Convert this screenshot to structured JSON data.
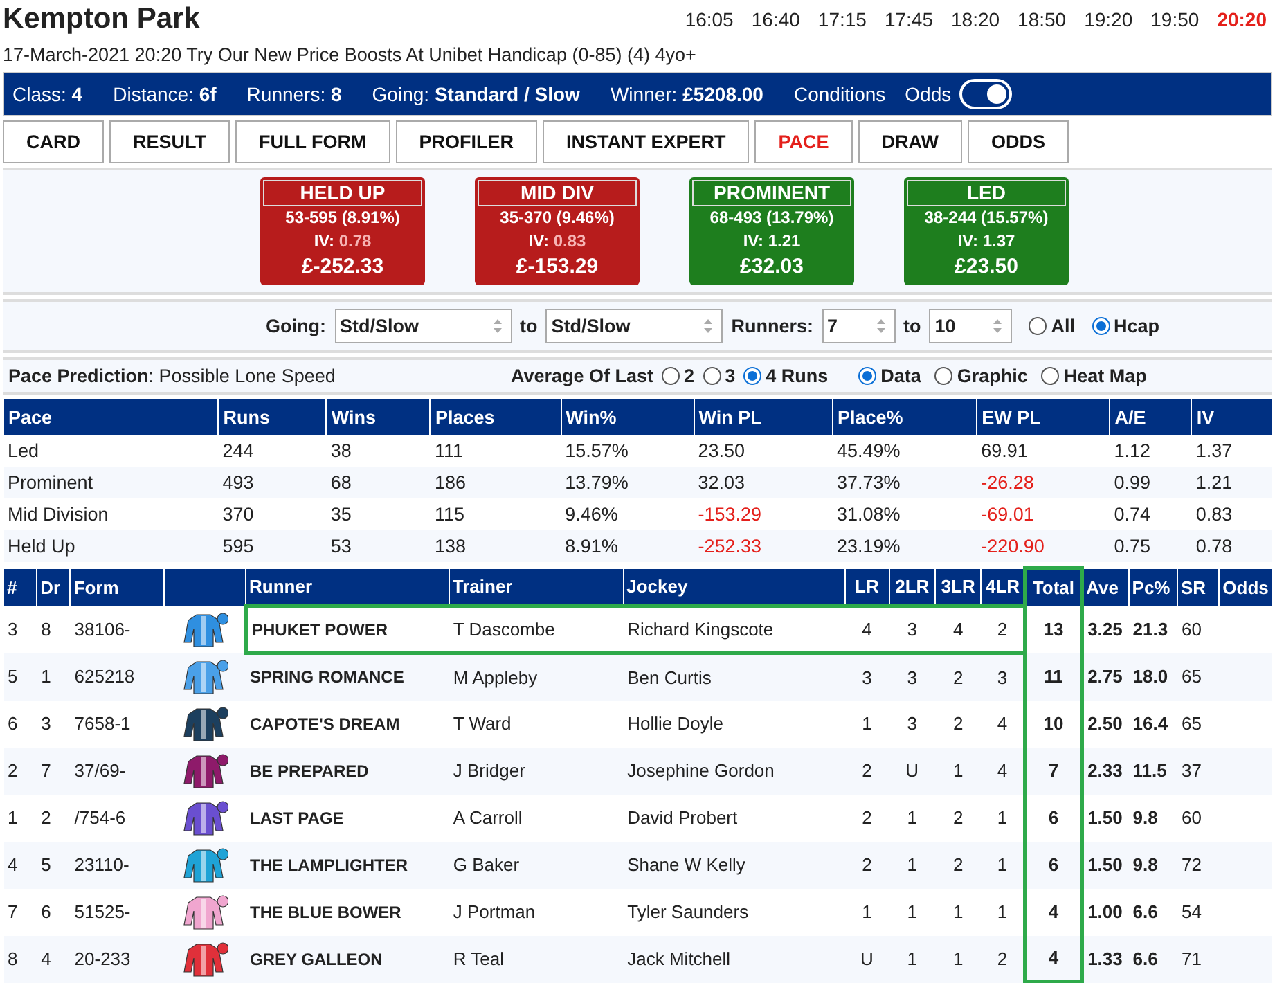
{
  "title": "Kempton Park",
  "times": [
    {
      "label": "16:05",
      "selected": false
    },
    {
      "label": "16:40",
      "selected": false
    },
    {
      "label": "17:15",
      "selected": false
    },
    {
      "label": "17:45",
      "selected": false
    },
    {
      "label": "18:20",
      "selected": false
    },
    {
      "label": "18:50",
      "selected": false
    },
    {
      "label": "19:20",
      "selected": false
    },
    {
      "label": "19:50",
      "selected": false
    },
    {
      "label": "20:20",
      "selected": true
    }
  ],
  "subtitle": "17-March-2021 20:20 Try Our New Price Boosts At Unibet Handicap (0-85) (4) 4yo+",
  "info": [
    {
      "label": "Class:",
      "value": "4"
    },
    {
      "label": "Distance:",
      "value": "6f"
    },
    {
      "label": "Runners:",
      "value": "8"
    },
    {
      "label": "Going:",
      "value": "Standard / Slow"
    },
    {
      "label": "Winner:",
      "value": "£5208.00"
    }
  ],
  "conditions": "Conditions",
  "odds_toggle": {
    "label": "Odds",
    "on": true
  },
  "tabs": [
    {
      "label": "CARD",
      "selected": false
    },
    {
      "label": "RESULT",
      "selected": false
    },
    {
      "label": "FULL FORM",
      "selected": false
    },
    {
      "label": "PROFILER",
      "selected": false
    },
    {
      "label": "INSTANT EXPERT",
      "selected": false
    },
    {
      "label": "PACE",
      "selected": true
    },
    {
      "label": "DRAW",
      "selected": false
    },
    {
      "label": "ODDS",
      "selected": false
    }
  ],
  "pace_boxes": [
    {
      "title": "HELD UP",
      "record": "53-595 (8.91%)",
      "iv_label": "IV:",
      "iv": "0.78",
      "iv_low": true,
      "pl": "£-252.33",
      "color": "#b71c1c"
    },
    {
      "title": "MID DIV",
      "record": "35-370 (9.46%)",
      "iv_label": "IV:",
      "iv": "0.83",
      "iv_low": true,
      "pl": "£-153.29",
      "color": "#b71c1c"
    },
    {
      "title": "PROMINENT",
      "record": "68-493 (13.79%)",
      "iv_label": "IV:",
      "iv": "1.21",
      "iv_low": false,
      "pl": "£32.03",
      "color": "#1e7e1e"
    },
    {
      "title": "LED",
      "record": "38-244 (15.57%)",
      "iv_label": "IV:",
      "iv": "1.37",
      "iv_low": false,
      "pl": "£23.50",
      "color": "#1e7e1e"
    }
  ],
  "filters": {
    "going_label": "Going:",
    "going_from": "Std/Slow",
    "to_label_1": "to",
    "going_to": "Std/Slow",
    "runners_label": "Runners:",
    "runners_from": "7",
    "to_label_2": "to",
    "runners_to": "10",
    "scope": [
      {
        "label": "All",
        "selected": false
      },
      {
        "label": "Hcap",
        "selected": true
      }
    ]
  },
  "prediction": {
    "label": "Pace Prediction",
    "value": ": Possible Lone Speed",
    "average_label": "Average Of Last",
    "average": [
      {
        "label": "2",
        "selected": false
      },
      {
        "label": "3",
        "selected": false
      },
      {
        "label": "4 Runs",
        "selected": true
      }
    ],
    "view": [
      {
        "label": "Data",
        "selected": true
      },
      {
        "label": "Graphic",
        "selected": false
      },
      {
        "label": "Heat Map",
        "selected": false
      }
    ]
  },
  "pace_table": {
    "columns": [
      "Pace",
      "Runs",
      "Wins",
      "Places",
      "Win%",
      "Win PL",
      "Place%",
      "EW PL",
      "A/E",
      "IV"
    ],
    "rows": [
      {
        "pace": "Led",
        "runs": "244",
        "wins": "38",
        "places": "111",
        "win_pct": "15.57%",
        "win_pl": {
          "value": "23.50",
          "negative": false
        },
        "place_pct": "45.49%",
        "ew_pl": {
          "value": "69.91",
          "negative": false
        },
        "ae": "1.12",
        "iv": "1.37"
      },
      {
        "pace": "Prominent",
        "runs": "493",
        "wins": "68",
        "places": "186",
        "win_pct": "13.79%",
        "win_pl": {
          "value": "32.03",
          "negative": false
        },
        "place_pct": "37.73%",
        "ew_pl": {
          "value": "-26.28",
          "negative": true
        },
        "ae": "0.99",
        "iv": "1.21"
      },
      {
        "pace": "Mid Division",
        "runs": "370",
        "wins": "35",
        "places": "115",
        "win_pct": "9.46%",
        "win_pl": {
          "value": "-153.29",
          "negative": true
        },
        "place_pct": "31.08%",
        "ew_pl": {
          "value": "-69.01",
          "negative": true
        },
        "ae": "0.74",
        "iv": "0.83"
      },
      {
        "pace": "Held Up",
        "runs": "595",
        "wins": "53",
        "places": "138",
        "win_pct": "8.91%",
        "win_pl": {
          "value": "-252.33",
          "negative": true
        },
        "place_pct": "23.19%",
        "ew_pl": {
          "value": "-220.90",
          "negative": true
        },
        "ae": "0.75",
        "iv": "0.78"
      }
    ]
  },
  "runners_table": {
    "columns": [
      {
        "label": "#",
        "highlighted": false
      },
      {
        "label": "Dr",
        "highlighted": false
      },
      {
        "label": "Form",
        "highlighted": false
      },
      {
        "highlighted": false
      },
      {
        "label": "Runner",
        "highlighted": false
      },
      {
        "label": "Trainer",
        "highlighted": false
      },
      {
        "label": "Jockey",
        "highlighted": false
      },
      {
        "label": "LR",
        "highlighted": false
      },
      {
        "label": "2LR",
        "highlighted": false
      },
      {
        "label": "3LR",
        "highlighted": false
      },
      {
        "label": "4LR",
        "highlighted": false
      },
      {
        "label": "Total",
        "highlighted": true
      },
      {
        "label": "Ave",
        "highlighted": false
      },
      {
        "label": "Pc%",
        "highlighted": false
      },
      {
        "label": "SR",
        "highlighted": false
      },
      {
        "label": "Odds",
        "highlighted": false
      }
    ],
    "rows": [
      {
        "no": "3",
        "draw": "8",
        "form": "38106-",
        "color": "#2f8fe0",
        "runner": "PHUKET POWER",
        "trainer": "T Dascombe",
        "jockey": "Richard Kingscote",
        "lr": "4",
        "lr2": "3",
        "lr3": "4",
        "lr4": "2",
        "total": "13",
        "ave": "3.25",
        "pc": "21.3",
        "sr": "60",
        "highlighted": true
      },
      {
        "no": "5",
        "draw": "1",
        "form": "625218",
        "color": "#4aa0e8",
        "runner": "SPRING ROMANCE",
        "trainer": "M Appleby",
        "jockey": "Ben Curtis",
        "lr": "3",
        "lr2": "3",
        "lr3": "2",
        "lr4": "3",
        "total": "11",
        "ave": "2.75",
        "pc": "18.0",
        "sr": "65",
        "highlighted": false
      },
      {
        "no": "6",
        "draw": "3",
        "form": "7658-1",
        "color": "#1c3f5e",
        "runner": "CAPOTE'S DREAM",
        "trainer": "T Ward",
        "jockey": "Hollie Doyle",
        "lr": "1",
        "lr2": "3",
        "lr3": "2",
        "lr4": "4",
        "total": "10",
        "ave": "2.50",
        "pc": "16.4",
        "sr": "65",
        "highlighted": false
      },
      {
        "no": "2",
        "draw": "7",
        "form": "37/69-",
        "color": "#8e1a6a",
        "runner": "BE PREPARED",
        "trainer": "J Bridger",
        "jockey": "Josephine Gordon",
        "lr": "2",
        "lr2": "U",
        "lr3": "1",
        "lr4": "4",
        "total": "7",
        "ave": "2.33",
        "pc": "11.5",
        "sr": "37",
        "highlighted": false
      },
      {
        "no": "1",
        "draw": "2",
        "form": "/754-6",
        "color": "#6a4fd0",
        "runner": "LAST PAGE",
        "trainer": "A Carroll",
        "jockey": "David Probert",
        "lr": "2",
        "lr2": "1",
        "lr3": "2",
        "lr4": "1",
        "total": "6",
        "ave": "1.50",
        "pc": "9.8",
        "sr": "60",
        "highlighted": false
      },
      {
        "no": "4",
        "draw": "5",
        "form": "23110-",
        "color": "#1fa3d6",
        "runner": "THE LAMPLIGHTER",
        "trainer": "G Baker",
        "jockey": "Shane W Kelly",
        "lr": "2",
        "lr2": "1",
        "lr3": "2",
        "lr4": "1",
        "total": "6",
        "ave": "1.50",
        "pc": "9.8",
        "sr": "72",
        "highlighted": false
      },
      {
        "no": "7",
        "draw": "6",
        "form": "51525-",
        "color": "#f0a6cf",
        "runner": "THE BLUE BOWER",
        "trainer": "J Portman",
        "jockey": "Tyler Saunders",
        "lr": "1",
        "lr2": "1",
        "lr3": "1",
        "lr4": "1",
        "total": "4",
        "ave": "1.00",
        "pc": "6.6",
        "sr": "54",
        "highlighted": false
      },
      {
        "no": "8",
        "draw": "4",
        "form": "20-233",
        "color": "#e0303a",
        "runner": "GREY GALLEON",
        "trainer": "R Teal",
        "jockey": "Jack Mitchell",
        "lr": "U",
        "lr2": "1",
        "lr3": "1",
        "lr4": "2",
        "total": "4",
        "ave": "1.33",
        "pc": "6.6",
        "sr": "71",
        "highlighted": false
      }
    ]
  }
}
